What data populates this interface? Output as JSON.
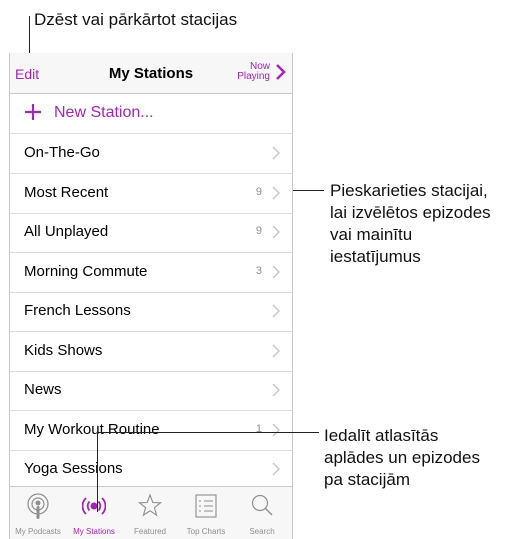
{
  "annotations": {
    "top": "Dzēst vai pārkārtot stacijas",
    "right_1": [
      "Pieskarieties stacijai,",
      "lai izvēlētos epizodes",
      "vai mainītu",
      "iestatījumus"
    ],
    "right_2": [
      "Iedalīt atlasītās",
      "aplādes un epizodes",
      "pa stacijām"
    ]
  },
  "navbar": {
    "edit_label": "Edit",
    "title": "My Stations",
    "now_playing_line1": "Now",
    "now_playing_line2": "Playing"
  },
  "new_station_label": "New Station...",
  "stations": [
    {
      "name": "On-The-Go",
      "count": ""
    },
    {
      "name": "Most Recent",
      "count": "9"
    },
    {
      "name": "All Unplayed",
      "count": "9"
    },
    {
      "name": "Morning Commute",
      "count": "3"
    },
    {
      "name": "French Lessons",
      "count": ""
    },
    {
      "name": "Kids Shows",
      "count": ""
    },
    {
      "name": "News",
      "count": ""
    },
    {
      "name": "My Workout Routine",
      "count": "1"
    },
    {
      "name": "Yoga Sessions",
      "count": ""
    }
  ],
  "tabs": [
    {
      "label": "My Podcasts",
      "icon": "podcast-icon"
    },
    {
      "label": "My Stations",
      "icon": "broadcast-icon"
    },
    {
      "label": "Featured",
      "icon": "star-icon"
    },
    {
      "label": "Top Charts",
      "icon": "list-icon"
    },
    {
      "label": "Search",
      "icon": "search-icon"
    }
  ],
  "colors": {
    "accent": "#a126b5",
    "secondary": "#8e8e8e"
  }
}
